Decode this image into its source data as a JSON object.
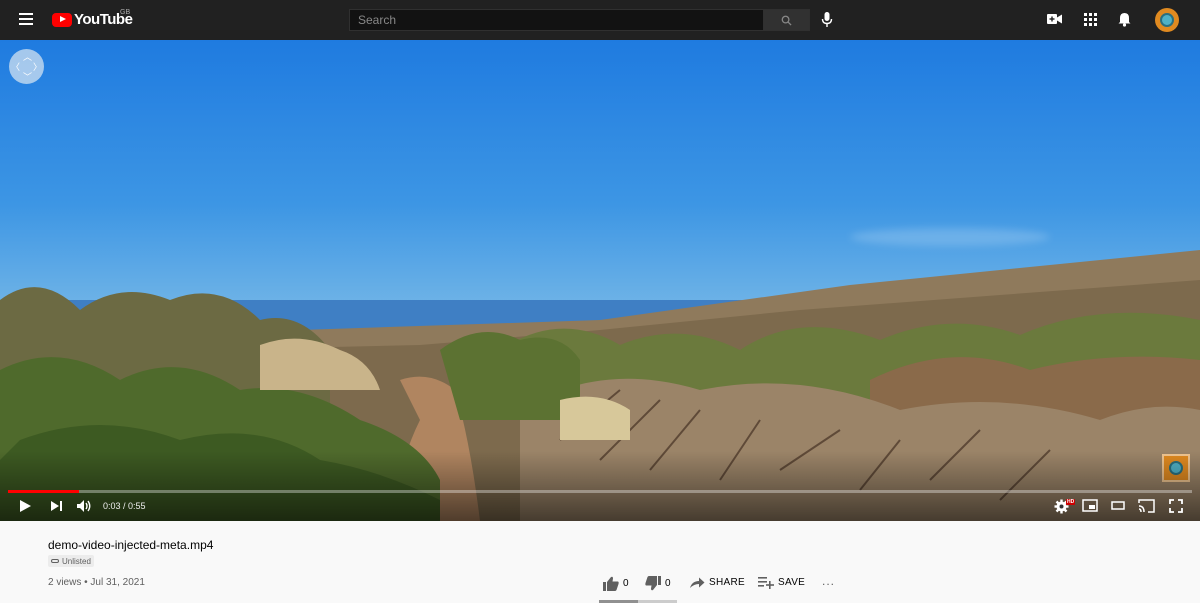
{
  "app": {
    "logo_text": "YouTube",
    "region": "GB"
  },
  "search": {
    "placeholder": "Search",
    "value": ""
  },
  "icons": {
    "menu": "hamburger-icon",
    "search": "search-icon",
    "mic": "mic-icon",
    "create": "video-camera-plus-icon",
    "apps": "apps-grid-icon",
    "notifications": "bell-icon",
    "avatar": "user-avatar"
  },
  "player": {
    "current_time": "0:03 / 0:55",
    "progress_fraction": 0.06,
    "settings_badge": "HD"
  },
  "video": {
    "title": "demo-video-injected-meta.mp4",
    "visibility": "Unlisted",
    "meta": "2 views • Jul 31, 2021"
  },
  "actions": {
    "likes": "0",
    "dislikes": "0",
    "share": "SHARE",
    "save": "SAVE",
    "more": "..."
  },
  "colors": {
    "brand_red": "#ff0000",
    "topbar_bg": "#212121",
    "avatar_orange": "#e08a20"
  }
}
